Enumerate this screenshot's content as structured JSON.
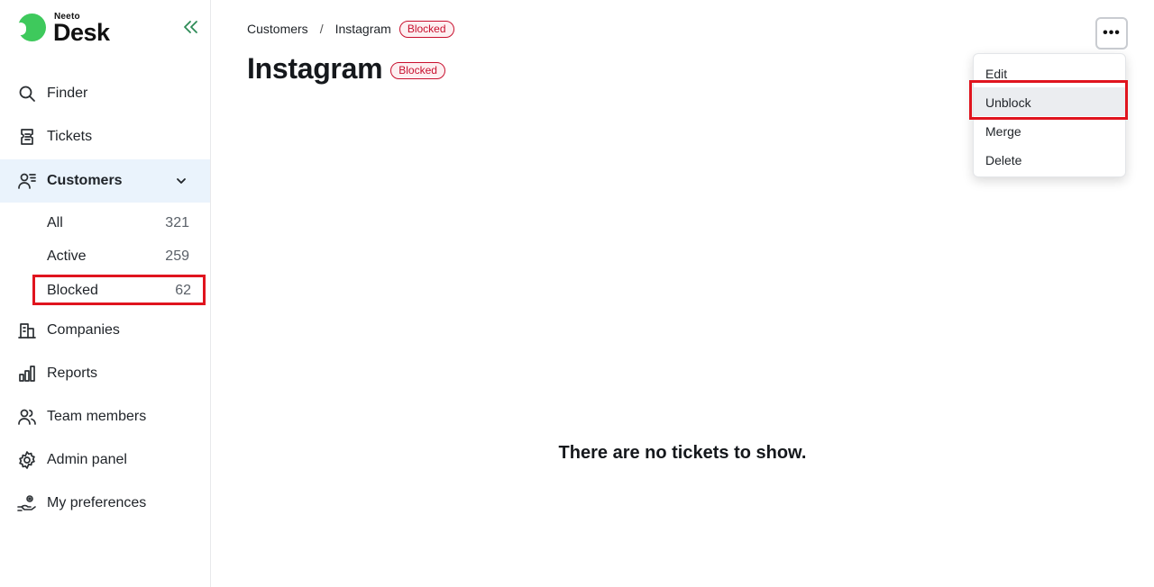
{
  "app": {
    "logo_small": "Neeto",
    "logo_big": "Desk",
    "brand_color": "#3ec95c"
  },
  "sidebar": {
    "items": [
      {
        "label": "Finder",
        "icon": "search-icon"
      },
      {
        "label": "Tickets",
        "icon": "ticket-icon"
      },
      {
        "label": "Customers",
        "icon": "customers-icon",
        "active": true
      },
      {
        "label": "Companies",
        "icon": "building-icon"
      },
      {
        "label": "Reports",
        "icon": "bar-chart-icon"
      },
      {
        "label": "Team members",
        "icon": "team-icon"
      },
      {
        "label": "Admin panel",
        "icon": "gear-icon"
      },
      {
        "label": "My preferences",
        "icon": "preferences-icon"
      }
    ],
    "customers_sub": [
      {
        "label": "All",
        "count": "321"
      },
      {
        "label": "Active",
        "count": "259"
      },
      {
        "label": "Blocked",
        "count": "62",
        "highlighted": true
      }
    ]
  },
  "header": {
    "breadcrumb": [
      "Customers",
      "Instagram"
    ],
    "breadcrumb_separator": "/",
    "status_badge": "Blocked",
    "title": "Instagram",
    "title_badge": "Blocked",
    "more_button": "•••"
  },
  "actions_menu": {
    "items": [
      "Edit",
      "Unblock",
      "Merge",
      "Delete"
    ],
    "hovered": "Unblock"
  },
  "main": {
    "empty_message": "There are no tickets to show."
  },
  "colors": {
    "badge_red": "#c8102e",
    "highlight_red": "#e0141e",
    "active_nav_bg": "#eaf3fc"
  }
}
